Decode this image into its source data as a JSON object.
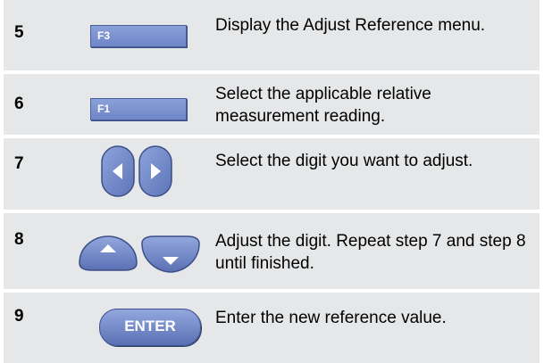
{
  "colors": {
    "row_background": "#e6e7e8",
    "key_blue": "#6f86c8",
    "key_text": "#ffffff"
  },
  "steps": [
    {
      "number": "5",
      "key": {
        "type": "function-key",
        "label": "F3"
      },
      "description": "Display the Adjust Reference menu."
    },
    {
      "number": "6",
      "key": {
        "type": "function-key",
        "label": "F1"
      },
      "description": "Select the applicable relative measurement reading."
    },
    {
      "number": "7",
      "key": {
        "type": "left-right-arrow-keys",
        "icons": [
          "left-arrow-icon",
          "right-arrow-icon"
        ]
      },
      "description": "Select the digit you want to adjust."
    },
    {
      "number": "8",
      "key": {
        "type": "up-down-arrow-keys",
        "icons": [
          "up-arrow-icon",
          "down-arrow-icon"
        ]
      },
      "description": "Adjust the digit. Repeat step 7 and step 8 until finished."
    },
    {
      "number": "9",
      "key": {
        "type": "enter-key",
        "label": "ENTER"
      },
      "description": "Enter the new reference value."
    }
  ]
}
